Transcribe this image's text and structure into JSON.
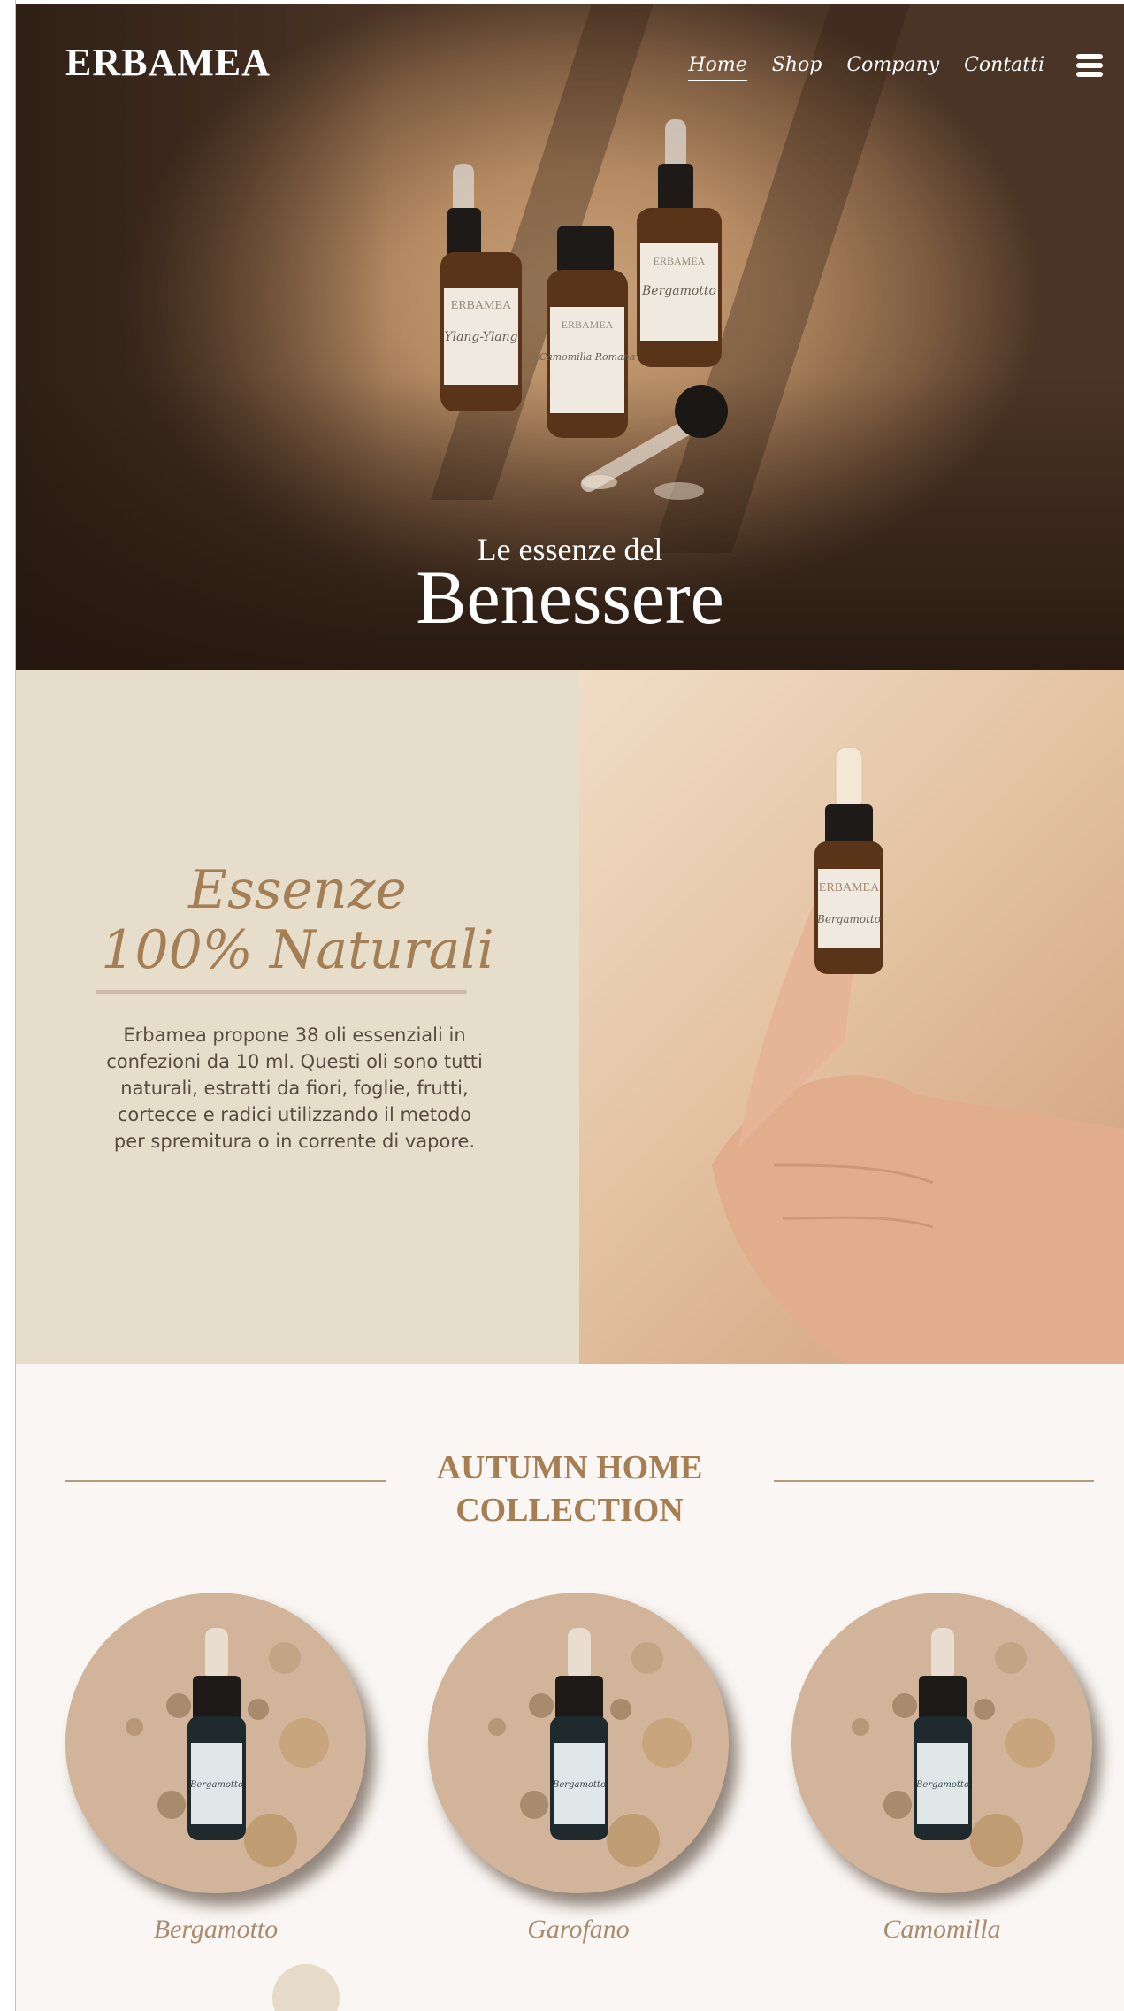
{
  "brand": {
    "logo": "ERBAMEA"
  },
  "nav": {
    "items": [
      {
        "label": "Home",
        "active": true
      },
      {
        "label": "Shop",
        "active": false
      },
      {
        "label": "Company",
        "active": false
      },
      {
        "label": "Contatti",
        "active": false
      }
    ],
    "menu_icon": "hamburger-icon"
  },
  "hero": {
    "subtitle": "Le  essenze del",
    "title": "Benessere",
    "bottle_labels": [
      "ERBAMEA",
      "Ylang-Ylang",
      "Camomilla Romana",
      "Bergamotto"
    ]
  },
  "essenze": {
    "title_line1": "Essenze",
    "title_line2": "100% Naturali",
    "text": "Erbamea propone 38 oli essenziali in confezioni da 10 ml. Questi oli sono tutti naturali, estratti da fiori, foglie, frutti, cortecce e radici utilizzando il metodo per spremitura o in corrente di vapore."
  },
  "hand_bottle": {
    "brand": "ERBAMEA",
    "name": "Bergamotto"
  },
  "collection": {
    "title": "AUTUMN HOME COLLECTION",
    "products": [
      {
        "name": "Bergamotto",
        "label": "Bergamotto"
      },
      {
        "name": "Garofano",
        "label": "Bergamotto"
      },
      {
        "name": "Camomilla",
        "label": "Bergamotto"
      }
    ]
  },
  "colors": {
    "accent_brown": "#a77e52",
    "beige_panel": "#e7ddcb",
    "page_bg": "#f9f6f3"
  }
}
